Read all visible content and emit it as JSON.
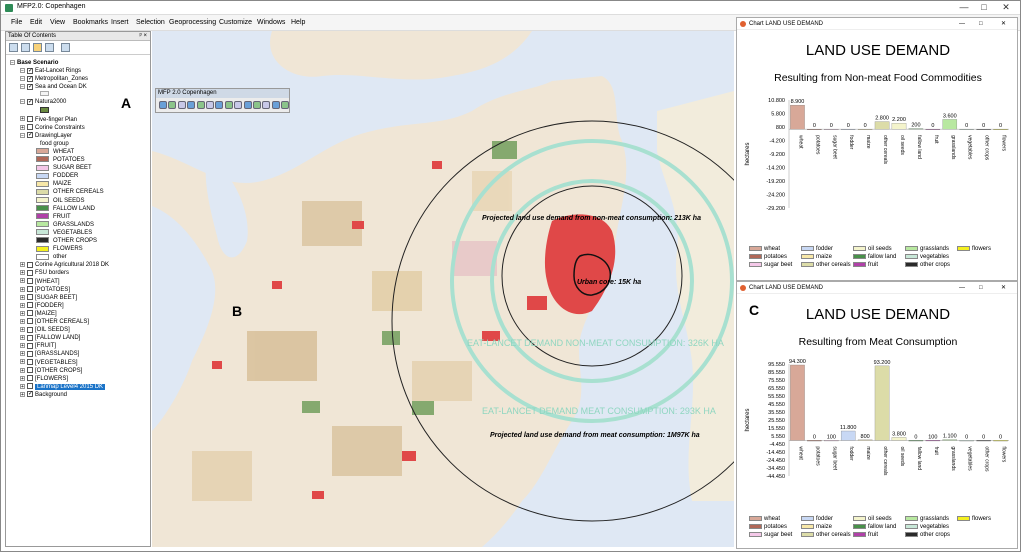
{
  "window": {
    "title": "MFP2.0: Copenhagen",
    "min": "—",
    "max": "□",
    "close": "✕"
  },
  "menu": [
    "File",
    "Edit",
    "View",
    "Bookmarks",
    "Insert",
    "Selection",
    "Geoprocessing",
    "Customize",
    "Windows",
    "Help"
  ],
  "toc": {
    "title": "Table Of Contents",
    "pin": "ᵖ ×",
    "root": "Base Scenario",
    "layers_top": [
      {
        "label": "Eat-Lancet Rings",
        "checked": true
      },
      {
        "label": "Metropolitan_Zones",
        "checked": true
      },
      {
        "label": "Sea and Ocean DK",
        "checked": true
      },
      {
        "label": "Natura2000",
        "checked": true
      },
      {
        "label": "Five-finger Plan",
        "checked": false
      },
      {
        "label": "Corine Constraints",
        "checked": false
      },
      {
        "label": "DrawingLayer",
        "checked": true
      }
    ],
    "group_label": "food group",
    "food_groups": [
      {
        "label": "WHEAT",
        "color": "#d8a898"
      },
      {
        "label": "POTATOES",
        "color": "#b06858"
      },
      {
        "label": "SUGAR BEET",
        "color": "#f4c8e8"
      },
      {
        "label": "FODDER",
        "color": "#c8d8f4"
      },
      {
        "label": "MAIZE",
        "color": "#f8e8a8"
      },
      {
        "label": "OTHER CEREALS",
        "color": "#dcdca8"
      },
      {
        "label": "OIL SEEDS",
        "color": "#f4f4cc"
      },
      {
        "label": "FALLOW LAND",
        "color": "#48904a"
      },
      {
        "label": "FRUIT",
        "color": "#b040a8"
      },
      {
        "label": "GRASSLANDS",
        "color": "#b8e8a0"
      },
      {
        "label": "VEGETABLES",
        "color": "#c8e8d8"
      },
      {
        "label": "OTHER CROPS",
        "color": "#2a2a2a"
      },
      {
        "label": "FLOWERS",
        "color": "#f4f020"
      },
      {
        "label": "other",
        "color": "#ffffff"
      }
    ],
    "layers_bottom": [
      {
        "label": "Corine Agricultural 2018 DK"
      },
      {
        "label": "FSU borders"
      },
      {
        "label": "[WHEAT]"
      },
      {
        "label": "[POTATOES]"
      },
      {
        "label": "[SUGAR BEET]"
      },
      {
        "label": "[FODDER]"
      },
      {
        "label": "[MAIZE]"
      },
      {
        "label": "[OTHER CEREALS]"
      },
      {
        "label": "[OIL SEEDS]"
      },
      {
        "label": "[FALLOW LAND]"
      },
      {
        "label": "[FRUIT]"
      },
      {
        "label": "[GRASSLANDS]"
      },
      {
        "label": "[VEGETABLES]"
      },
      {
        "label": "[OTHER CROPS]"
      },
      {
        "label": "[FLOWERS]"
      }
    ],
    "selected_layer": "Lanmap Level4 2015 DK",
    "background": "Background"
  },
  "mfp_toolbar_title": "MFP 2.0 Copenhagen",
  "map": {
    "label_A": "A",
    "label_B": "B",
    "label_C": "C",
    "annot_nonmeat": "Projected land use demand from non-meat consumption: 213K ha",
    "annot_urban": "Urban core: 15K ha",
    "annot_eat_nonmeat": "EAT-LANCET DEMAND NON-MEAT CONSUMPTION: 326K HA",
    "annot_eat_meat": "EAT-LANCET DEMAND MEAT CONSUMPTION: 293K HA",
    "annot_meat": "Projected land use demand from meat consumption: 1M97K ha"
  },
  "charts": [
    {
      "window_title": "Chart LAND USE DEMAND",
      "title": "LAND USE DEMAND",
      "subtitle": "Resulting from Non-meat Food Commodities",
      "chart_data": {
        "type": "bar",
        "title": "LAND USE DEMAND",
        "subtitle": "Resulting from Non-meat Food Commodities",
        "ylabel": "hectares",
        "yticks": [
          "10.800",
          "5.800",
          "800",
          "-4.200",
          "-9.200",
          "-14.200",
          "-19.200",
          "-24.200",
          "-29.200"
        ],
        "categories": [
          "wheat",
          "potatoes",
          "sugar beet",
          "fodder",
          "maize",
          "other cereals",
          "oil seeds",
          "fallow land",
          "fruit",
          "grasslands",
          "vegetables",
          "other crops",
          "flowers"
        ],
        "values": [
          8900,
          0,
          0,
          0,
          0,
          2800,
          2200,
          200,
          0,
          3600,
          0,
          0,
          0
        ],
        "labels": [
          "8.900",
          "0",
          "0",
          "0",
          "0",
          "2.800",
          "2.200",
          "200",
          "0",
          "3.600",
          "0",
          "0",
          "0"
        ],
        "ylim": [
          -29200,
          10800
        ]
      }
    },
    {
      "window_title": "Chart LAND USE DEMAND",
      "title": "LAND USE DEMAND",
      "subtitle": "Resulting from Meat Consumption",
      "chart_data": {
        "type": "bar",
        "title": "LAND USE DEMAND",
        "subtitle": "Resulting from Meat Consumption",
        "ylabel": "hectares",
        "yticks": [
          "95.550",
          "85.550",
          "75.550",
          "65.550",
          "55.550",
          "45.550",
          "35.550",
          "25.550",
          "15.550",
          "5.550",
          "-4.450",
          "-14.450",
          "-24.450",
          "-34.450",
          "-44.450"
        ],
        "categories": [
          "wheat",
          "potatoes",
          "sugar beet",
          "fodder",
          "maize",
          "other cereals",
          "oil seeds",
          "fallow land",
          "fruit",
          "grasslands",
          "vegetables",
          "other crops",
          "flowers"
        ],
        "values": [
          94300,
          0,
          100,
          11800,
          800,
          93200,
          3800,
          0,
          100,
          1100,
          0,
          0,
          0
        ],
        "labels": [
          "94.300",
          "0",
          "100",
          "11.800",
          "800",
          "93.200",
          "3.800",
          "0",
          "100",
          "1.100",
          "0",
          "0",
          "0"
        ],
        "ylim": [
          -44450,
          95550
        ]
      }
    }
  ],
  "legend": [
    {
      "label": "wheat",
      "color": "#d8a898"
    },
    {
      "label": "potatoes",
      "color": "#b06858"
    },
    {
      "label": "sugar beet",
      "color": "#f4c8e8"
    },
    {
      "label": "fodder",
      "color": "#c8d8f4"
    },
    {
      "label": "maize",
      "color": "#f8e8a8"
    },
    {
      "label": "other cereals",
      "color": "#dcdca8"
    },
    {
      "label": "oil seeds",
      "color": "#f4f4cc"
    },
    {
      "label": "fallow land",
      "color": "#48904a"
    },
    {
      "label": "fruit",
      "color": "#b040a8"
    },
    {
      "label": "grasslands",
      "color": "#b8e8a0"
    },
    {
      "label": "vegetables",
      "color": "#c8e8d8"
    },
    {
      "label": "other crops",
      "color": "#2a2a2a"
    },
    {
      "label": "flowers",
      "color": "#f4f020"
    }
  ]
}
